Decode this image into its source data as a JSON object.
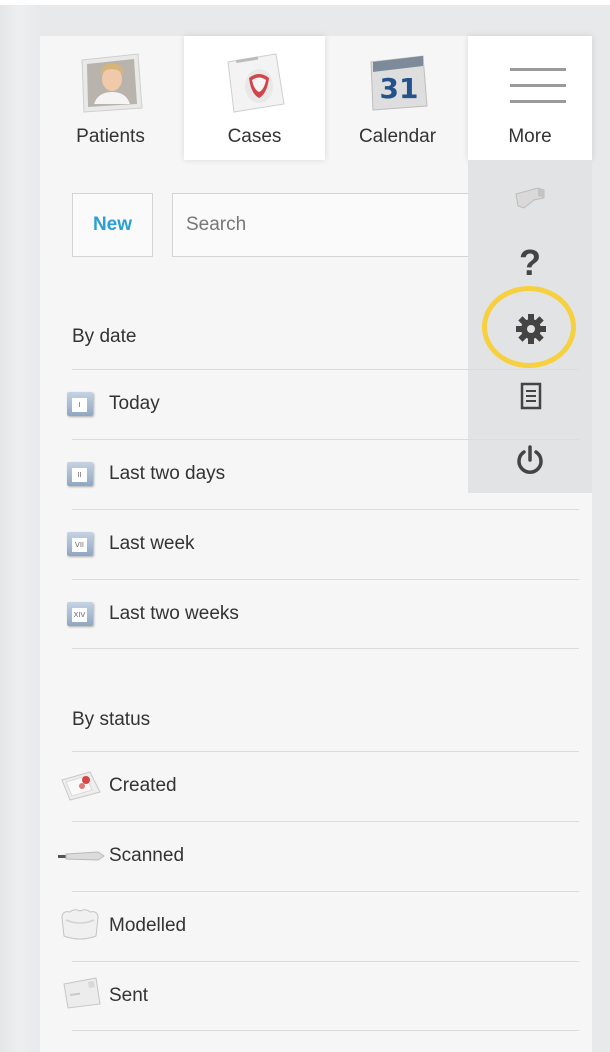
{
  "nav": {
    "items": [
      {
        "label": "Patients",
        "icon": "patient-photo-icon"
      },
      {
        "label": "Cases",
        "icon": "cases-document-icon"
      },
      {
        "label": "Calendar",
        "icon": "calendar-icon",
        "day": "31"
      },
      {
        "label": "More",
        "icon": "hamburger-menu-icon"
      }
    ],
    "active": "Cases"
  },
  "more_menu": {
    "items": [
      {
        "icon": "scanner-device-icon"
      },
      {
        "icon": "help-question-icon",
        "glyph": "?"
      },
      {
        "icon": "gear-settings-icon",
        "highlighted": true
      },
      {
        "icon": "document-list-icon"
      },
      {
        "icon": "power-icon"
      }
    ],
    "highlight_color": "#f6d03f"
  },
  "toolbar": {
    "new_label": "New",
    "search_placeholder": "Search"
  },
  "by_date": {
    "heading": "By date",
    "items": [
      {
        "label": "Today",
        "icon_numeral": "I"
      },
      {
        "label": "Last two days",
        "icon_numeral": "II"
      },
      {
        "label": "Last week",
        "icon_numeral": "VII"
      },
      {
        "label": "Last two weeks",
        "icon_numeral": "XIV"
      }
    ]
  },
  "by_status": {
    "heading": "By status",
    "items": [
      {
        "label": "Created",
        "icon": "created-case-icon"
      },
      {
        "label": "Scanned",
        "icon": "scanner-wand-icon"
      },
      {
        "label": "Modelled",
        "icon": "dental-model-icon"
      },
      {
        "label": "Sent",
        "icon": "envelope-icon"
      }
    ]
  },
  "colors": {
    "accent": "#2aa0d6",
    "panel": "#f6f6f6",
    "menu": "#e2e3e4"
  }
}
